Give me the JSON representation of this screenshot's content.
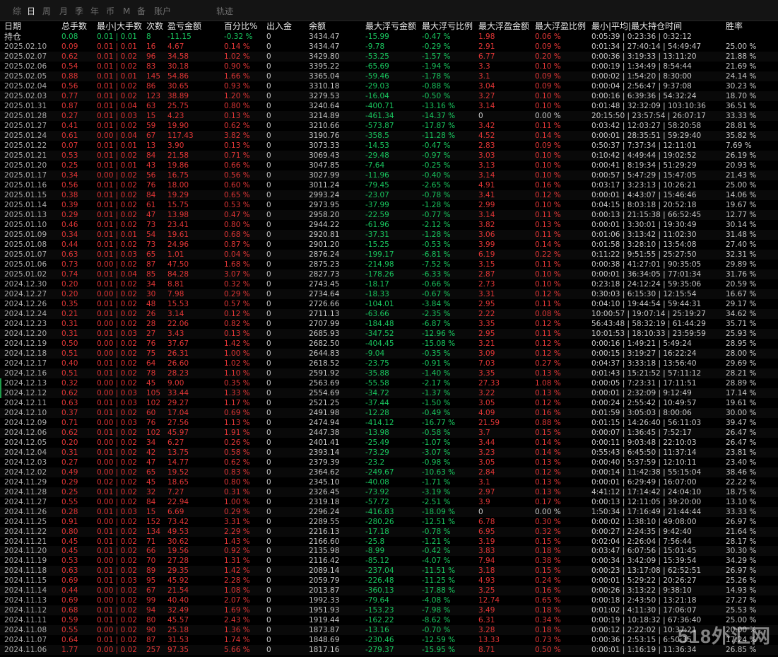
{
  "tabs": [
    {
      "label": "综",
      "active": false
    },
    {
      "label": "日",
      "active": true
    },
    {
      "label": "周",
      "active": false
    },
    {
      "label": "月",
      "active": false
    },
    {
      "label": "季",
      "active": false
    },
    {
      "label": "年",
      "active": false
    },
    {
      "label": "币",
      "active": false
    },
    {
      "label": "M",
      "active": false
    },
    {
      "label": "备",
      "active": false
    },
    {
      "label": "账户",
      "active": false
    },
    {
      "label": "轨迹",
      "active": false
    }
  ],
  "columns": [
    "日期",
    "总手数",
    "最小|大手数",
    "次数",
    "盈亏金额",
    "百分比%",
    "出入金",
    "余额",
    "最大浮亏金额",
    "最大浮亏比例",
    "最大浮盈金额",
    "最大浮盈比例",
    "最小|平均|最大持仓时间",
    "胜率"
  ],
  "holding": {
    "date": "持仓",
    "lots": "0.08",
    "minmax": "0.01 | 0.01",
    "count": "8",
    "pnl": "-11.15",
    "pct": "-0.32 %",
    "flow": "0",
    "balance": "3434.47",
    "maxloss": "-15.99",
    "maxloss_pct": "-0.47 %",
    "maxprofit": "1.98",
    "maxprofit_pct": "0.06 %",
    "time": "0:05:39 | 0:23:36 | 0:32:12",
    "winrate": ""
  },
  "rows": [
    [
      "2025.02.10",
      "0.09",
      "0.01 | 0.01",
      "16",
      "4.67",
      "0.14 %",
      "0",
      "3434.47",
      "-9.78",
      "-0.29 %",
      "2.91",
      "0.09 %",
      "0:01:34 | 27:40:14 | 54:49:47",
      "25.00 %"
    ],
    [
      "2025.02.07",
      "0.62",
      "0.01 | 0.02",
      "96",
      "34.58",
      "1.02 %",
      "0",
      "3429.80",
      "-53.25",
      "-1.57 %",
      "6.77",
      "0.20 %",
      "0:00:36 | 3:19:33 | 13:11:20",
      "21.88 %"
    ],
    [
      "2025.02.06",
      "0.54",
      "0.01 | 0.02",
      "83",
      "30.18",
      "0.90 %",
      "0",
      "3395.22",
      "-65.69",
      "-1.94 %",
      "3.3",
      "0.10 %",
      "0:00:19 | 1:34:49 | 8:54:44",
      "21.69 %"
    ],
    [
      "2025.02.05",
      "0.88",
      "0.01 | 0.01",
      "145",
      "54.86",
      "1.66 %",
      "0",
      "3365.04",
      "-59.46",
      "-1.78 %",
      "3.1",
      "0.09 %",
      "0:00:02 | 1:54:20 | 8:30:00",
      "24.14 %"
    ],
    [
      "2025.02.04",
      "0.56",
      "0.01 | 0.02",
      "86",
      "30.65",
      "0.93 %",
      "0",
      "3310.18",
      "-29.03",
      "-0.88 %",
      "3.04",
      "0.09 %",
      "0:00:04 | 2:56:47 | 9:37:08",
      "30.23 %"
    ],
    [
      "2025.02.03",
      "0.77",
      "0.01 | 0.02",
      "123",
      "38.89",
      "1.20 %",
      "0",
      "3279.53",
      "-16.04",
      "-0.50 %",
      "3.27",
      "0.10 %",
      "0:00:16 | 6:39:36 | 54:32:24",
      "18.70 %"
    ],
    [
      "2025.01.31",
      "0.87",
      "0.01 | 0.04",
      "63",
      "25.75",
      "0.80 %",
      "0",
      "3240.64",
      "-400.71",
      "-13.16 %",
      "3.14",
      "0.10 %",
      "0:01:48 | 32:32:09 | 103:10:36",
      "36.51 %"
    ],
    [
      "2025.01.28",
      "0.27",
      "0.01 | 0.03",
      "15",
      "4.23",
      "0.13 %",
      "0",
      "3214.89",
      "-461.34",
      "-14.37 %",
      "0",
      "0.00 %",
      "20:15:50 | 23:57:54 | 26:07:17",
      "33.33 %"
    ],
    [
      "2025.01.27",
      "0.41",
      "0.01 | 0.02",
      "59",
      "19.90",
      "0.62 %",
      "0",
      "3210.66",
      "-573.87",
      "-17.87 %",
      "3.42",
      "0.11 %",
      "0:03:42 | 12:03:27 | 58:20:58",
      "28.81 %"
    ],
    [
      "2025.01.24",
      "0.61",
      "0.00 | 0.04",
      "67",
      "117.43",
      "3.82 %",
      "0",
      "3190.76",
      "-358.5",
      "-11.28 %",
      "4.52",
      "0.14 %",
      "0:00:01 | 28:35:51 | 59:29:40",
      "35.82 %"
    ],
    [
      "2025.01.22",
      "0.07",
      "0.01 | 0.01",
      "13",
      "3.90",
      "0.13 %",
      "0",
      "3073.33",
      "-14.53",
      "-0.47 %",
      "2.83",
      "0.09 %",
      "0:50:37 | 7:37:34 | 12:11:01",
      "7.69 %"
    ],
    [
      "2025.01.21",
      "0.53",
      "0.01 | 0.02",
      "84",
      "21.58",
      "0.71 %",
      "0",
      "3069.43",
      "-29.48",
      "-0.97 %",
      "3.03",
      "0.10 %",
      "0:10:42 | 4:49:44 | 19:02:52",
      "26.19 %"
    ],
    [
      "2025.01.20",
      "0.25",
      "0.01 | 0.01",
      "43",
      "19.86",
      "0.66 %",
      "0",
      "3047.85",
      "-7.64",
      "-0.25 %",
      "3.13",
      "0.10 %",
      "0:00:41 | 8:19:34 | 51:29:29",
      "20.93 %"
    ],
    [
      "2025.01.17",
      "0.34",
      "0.00 | 0.02",
      "56",
      "16.75",
      "0.56 %",
      "0",
      "3027.99",
      "-11.96",
      "-0.40 %",
      "3.14",
      "0.10 %",
      "0:00:57 | 5:47:29 | 15:47:05",
      "21.43 %"
    ],
    [
      "2025.01.16",
      "0.56",
      "0.01 | 0.02",
      "76",
      "18.00",
      "0.60 %",
      "0",
      "3011.24",
      "-79.45",
      "-2.65 %",
      "4.91",
      "0.16 %",
      "0:03:17 | 3:23:13 | 10:26:21",
      "25.00 %"
    ],
    [
      "2025.01.15",
      "0.38",
      "0.01 | 0.02",
      "84",
      "19.29",
      "0.65 %",
      "0",
      "2993.24",
      "-23.07",
      "-0.78 %",
      "3.41",
      "0.12 %",
      "0:00:01 | 4:43:07 | 15:46:46",
      "14.06 %"
    ],
    [
      "2025.01.14",
      "0.39",
      "0.01 | 0.02",
      "61",
      "15.75",
      "0.53 %",
      "0",
      "2973.95",
      "-37.99",
      "-1.28 %",
      "2.99",
      "0.10 %",
      "0:04:15 | 8:03:18 | 20:52:18",
      "19.67 %"
    ],
    [
      "2025.01.13",
      "0.29",
      "0.01 | 0.02",
      "47",
      "13.98",
      "0.47 %",
      "0",
      "2958.20",
      "-22.59",
      "-0.77 %",
      "3.14",
      "0.11 %",
      "0:00:13 | 21:15:38 | 66:52:45",
      "12.77 %"
    ],
    [
      "2025.01.10",
      "0.46",
      "0.01 | 0.02",
      "73",
      "23.41",
      "0.80 %",
      "0",
      "2944.22",
      "-61.96",
      "-2.12 %",
      "3.82",
      "0.13 %",
      "0:00:01 | 3:30:01 | 19:30:49",
      "30.14 %"
    ],
    [
      "2025.01.09",
      "0.34",
      "0.01 | 0.01",
      "54",
      "19.61",
      "0.68 %",
      "0",
      "2920.81",
      "-37.31",
      "-1.28 %",
      "3.06",
      "0.11 %",
      "0:01:06 | 3:13:42 | 11:02:30",
      "31.48 %"
    ],
    [
      "2025.01.08",
      "0.44",
      "0.01 | 0.02",
      "73",
      "24.96",
      "0.87 %",
      "0",
      "2901.20",
      "-15.25",
      "-0.53 %",
      "3.99",
      "0.14 %",
      "0:01:58 | 3:28:10 | 13:54:08",
      "27.40 %"
    ],
    [
      "2025.01.07",
      "0.63",
      "0.01 | 0.03",
      "65",
      "1.01",
      "0.04 %",
      "0",
      "2876.24",
      "-199.17",
      "-6.81 %",
      "6.19",
      "0.22 %",
      "0:11:22 | 9:51:55 | 25:27:50",
      "32.31 %"
    ],
    [
      "2025.01.06",
      "0.73",
      "0.00 | 0.02",
      "87",
      "47.50",
      "1.68 %",
      "0",
      "2875.23",
      "-214.98",
      "-7.52 %",
      "3.15",
      "0.11 %",
      "0:00:38 | 41:27:01 | 90:35:05",
      "29.89 %"
    ],
    [
      "2025.01.02",
      "0.74",
      "0.01 | 0.04",
      "85",
      "84.28",
      "3.07 %",
      "0",
      "2827.73",
      "-178.26",
      "-6.33 %",
      "2.87",
      "0.10 %",
      "0:00:01 | 36:34:05 | 77:01:34",
      "31.76 %"
    ],
    [
      "2024.12.30",
      "0.20",
      "0.01 | 0.02",
      "34",
      "8.81",
      "0.32 %",
      "0",
      "2743.45",
      "-18.17",
      "-0.66 %",
      "2.73",
      "0.10 %",
      "0:23:18 | 24:12:24 | 59:35:06",
      "20.59 %"
    ],
    [
      "2024.12.27",
      "0.20",
      "0.00 | 0.02",
      "30",
      "7.98",
      "0.29 %",
      "0",
      "2734.64",
      "-18.33",
      "-0.67 %",
      "3.31",
      "0.12 %",
      "0:30:03 | 6:15:30 | 12:15:54",
      "16.67 %"
    ],
    [
      "2024.12.26",
      "0.35",
      "0.01 | 0.02",
      "48",
      "15.53",
      "0.57 %",
      "0",
      "2726.66",
      "-104.01",
      "-3.84 %",
      "2.95",
      "0.11 %",
      "0:04:10 | 19:44:54 | 59:44:31",
      "29.17 %"
    ],
    [
      "2024.12.24",
      "0.21",
      "0.01 | 0.02",
      "26",
      "3.14",
      "0.12 %",
      "0",
      "2711.13",
      "-63.66",
      "-2.35 %",
      "2.22",
      "0.08 %",
      "10:00:57 | 19:07:14 | 25:19:27",
      "34.62 %"
    ],
    [
      "2024.12.23",
      "0.31",
      "0.00 | 0.02",
      "28",
      "22.06",
      "0.82 %",
      "0",
      "2707.99",
      "-184.48",
      "-6.87 %",
      "3.35",
      "0.12 %",
      "56:43:48 | 58:32:19 | 61:44:29",
      "35.71 %"
    ],
    [
      "2024.12.20",
      "0.31",
      "0.01 | 0.03",
      "27",
      "3.43",
      "0.13 %",
      "0",
      "2685.93",
      "-347.52",
      "-12.96 %",
      "2.95",
      "0.11 %",
      "10:01:53 | 18:10:33 | 23:59:59",
      "25.93 %"
    ],
    [
      "2024.12.19",
      "0.50",
      "0.00 | 0.02",
      "76",
      "37.67",
      "1.42 %",
      "0",
      "2682.50",
      "-404.45",
      "-15.08 %",
      "3.21",
      "0.12 %",
      "0:00:16 | 1:49:21 | 5:49:24",
      "28.95 %"
    ],
    [
      "2024.12.18",
      "0.51",
      "0.00 | 0.02",
      "75",
      "26.31",
      "1.00 %",
      "0",
      "2644.83",
      "-9.04",
      "-0.35 %",
      "3.09",
      "0.12 %",
      "0:00:15 | 3:19:27 | 16:22:24",
      "28.00 %"
    ],
    [
      "2024.12.17",
      "0.40",
      "0.01 | 0.02",
      "64",
      "26.60",
      "1.02 %",
      "0",
      "2618.52",
      "-23.75",
      "-0.91 %",
      "7.03",
      "0.27 %",
      "0:04:37 | 3:33:18 | 13:56:40",
      "29.69 %"
    ],
    [
      "2024.12.16",
      "0.51",
      "0.01 | 0.02",
      "78",
      "28.23",
      "1.10 %",
      "0",
      "2591.92",
      "-35.88",
      "-1.40 %",
      "3.35",
      "0.13 %",
      "0:01:43 | 15:21:52 | 57:11:12",
      "28.21 %"
    ],
    [
      "2024.12.13",
      "0.32",
      "0.00 | 0.02",
      "45",
      "9.00",
      "0.35 %",
      "0",
      "2563.69",
      "-55.58",
      "-2.17 %",
      "27.33",
      "1.08 %",
      "0:00:05 | 7:23:31 | 17:11:51",
      "28.89 %"
    ],
    [
      "2024.12.12",
      "0.62",
      "0.00 | 0.03",
      "105",
      "33.44",
      "1.33 %",
      "0",
      "2554.69",
      "-34.72",
      "-1.37 %",
      "3.22",
      "0.13 %",
      "0:00:01 | 2:32:09 | 9:12:49",
      "17.14 %"
    ],
    [
      "2024.12.11",
      "0.63",
      "0.01 | 0.03",
      "102",
      "29.27",
      "1.17 %",
      "0",
      "2521.25",
      "-37.44",
      "-1.50 %",
      "3.05",
      "0.12 %",
      "0:00:24 | 2:55:42 | 10:49:57",
      "19.61 %"
    ],
    [
      "2024.12.10",
      "0.37",
      "0.01 | 0.02",
      "60",
      "17.04",
      "0.69 %",
      "0",
      "2491.98",
      "-12.28",
      "-0.49 %",
      "4.09",
      "0.16 %",
      "0:01:59 | 3:05:03 | 8:00:06",
      "30.00 %"
    ],
    [
      "2024.12.09",
      "0.71",
      "0.00 | 0.03",
      "76",
      "27.56",
      "1.13 %",
      "0",
      "2474.94",
      "-414.12",
      "-16.77 %",
      "21.59",
      "0.88 %",
      "0:01:15 | 14:26:40 | 56:11:03",
      "39.47 %"
    ],
    [
      "2024.12.06",
      "0.62",
      "0.01 | 0.02",
      "102",
      "45.97",
      "1.91 %",
      "0",
      "2447.38",
      "-13.98",
      "-0.58 %",
      "3.7",
      "0.15 %",
      "0:00:07 | 1:36:45 | 7:52:17",
      "26.47 %"
    ],
    [
      "2024.12.05",
      "0.20",
      "0.00 | 0.02",
      "34",
      "6.27",
      "0.26 %",
      "0",
      "2401.41",
      "-25.49",
      "-1.07 %",
      "3.44",
      "0.14 %",
      "0:00:11 | 9:03:48 | 22:10:03",
      "26.47 %"
    ],
    [
      "2024.12.04",
      "0.31",
      "0.01 | 0.02",
      "42",
      "13.75",
      "0.58 %",
      "0",
      "2393.14",
      "-73.29",
      "-3.07 %",
      "3.23",
      "0.14 %",
      "0:55:43 | 6:45:50 | 11:37:14",
      "23.81 %"
    ],
    [
      "2024.12.03",
      "0.27",
      "0.00 | 0.02",
      "47",
      "14.77",
      "0.62 %",
      "0",
      "2379.39",
      "-23.2",
      "-0.98 %",
      "3.05",
      "0.13 %",
      "0:00:40 | 5:37:59 | 12:10:11",
      "23.40 %"
    ],
    [
      "2024.12.02",
      "0.49",
      "0.00 | 0.02",
      "65",
      "19.52",
      "0.83 %",
      "0",
      "2364.62",
      "-249.67",
      "-10.63 %",
      "2.84",
      "0.12 %",
      "0:00:14 | 11:42:38 | 55:15:04",
      "38.46 %"
    ],
    [
      "2024.11.29",
      "0.29",
      "0.02 | 0.02",
      "45",
      "18.65",
      "0.80 %",
      "0",
      "2345.10",
      "-40.08",
      "-1.71 %",
      "3.1",
      "0.13 %",
      "0:00:01 | 6:29:49 | 16:07:00",
      "22.22 %"
    ],
    [
      "2024.11.28",
      "0.25",
      "0.01 | 0.02",
      "32",
      "7.27",
      "0.31 %",
      "0",
      "2326.45",
      "-73.92",
      "-3.19 %",
      "2.97",
      "0.13 %",
      "4:41:12 | 17:14:42 | 24:04:10",
      "18.75 %"
    ],
    [
      "2024.11.27",
      "0.55",
      "0.00 | 0.02",
      "84",
      "22.94",
      "1.00 %",
      "0",
      "2319.18",
      "-57.72",
      "-2.51 %",
      "3.9",
      "0.17 %",
      "0:00:13 | 12:11:05 | 39:20:00",
      "13.10 %"
    ],
    [
      "2024.11.26",
      "0.28",
      "0.01 | 0.03",
      "15",
      "6.69",
      "0.29 %",
      "0",
      "2296.24",
      "-416.83",
      "-18.09 %",
      "0",
      "0.00 %",
      "1:50:34 | 17:16:49 | 21:44:44",
      "33.33 %"
    ],
    [
      "2024.11.25",
      "0.91",
      "0.00 | 0.02",
      "152",
      "73.42",
      "3.31 %",
      "0",
      "2289.55",
      "-280.26",
      "-12.51 %",
      "6.78",
      "0.30 %",
      "0:00:02 | 1:38:10 | 49:08:00",
      "26.97 %"
    ],
    [
      "2024.11.22",
      "0.80",
      "0.01 | 0.02",
      "134",
      "49.53",
      "2.29 %",
      "0",
      "2216.13",
      "-17.18",
      "-0.78 %",
      "6.95",
      "0.32 %",
      "0:00:27 | 2:24:35 | 9:42:40",
      "21.64 %"
    ],
    [
      "2024.11.21",
      "0.45",
      "0.01 | 0.02",
      "71",
      "30.62",
      "1.43 %",
      "0",
      "2166.60",
      "-25.8",
      "-1.21 %",
      "3.19",
      "0.15 %",
      "0:02:04 | 2:26:04 | 7:56:44",
      "28.17 %"
    ],
    [
      "2024.11.20",
      "0.45",
      "0.01 | 0.02",
      "66",
      "19.56",
      "0.92 %",
      "0",
      "2135.98",
      "-8.99",
      "-0.42 %",
      "3.83",
      "0.18 %",
      "0:03:47 | 6:07:56 | 15:01:45",
      "30.30 %"
    ],
    [
      "2024.11.19",
      "0.53",
      "0.00 | 0.02",
      "70",
      "27.28",
      "1.31 %",
      "0",
      "2116.42",
      "-85.12",
      "-4.07 %",
      "7.94",
      "0.38 %",
      "0:00:34 | 3:42:09 | 15:39:54",
      "34.29 %"
    ],
    [
      "2024.11.18",
      "0.63",
      "0.01 | 0.02",
      "89",
      "29.35",
      "1.42 %",
      "0",
      "2089.14",
      "-237.04",
      "-11.51 %",
      "3.18",
      "0.15 %",
      "0:00:23 | 13:17:08 | 62:52:51",
      "26.97 %"
    ],
    [
      "2024.11.15",
      "0.69",
      "0.01 | 0.03",
      "95",
      "45.92",
      "2.28 %",
      "0",
      "2059.79",
      "-226.48",
      "-11.25 %",
      "4.93",
      "0.24 %",
      "0:00:01 | 5:29:22 | 20:26:27",
      "25.26 %"
    ],
    [
      "2024.11.14",
      "0.44",
      "0.00 | 0.02",
      "67",
      "21.54",
      "1.08 %",
      "0",
      "2013.87",
      "-360.13",
      "-17.88 %",
      "3.25",
      "0.16 %",
      "0:00:26 | 3:13:22 | 9:38:10",
      "14.93 %"
    ],
    [
      "2024.11.13",
      "0.69",
      "0.00 | 0.02",
      "99",
      "40.40",
      "2.07 %",
      "0",
      "1992.33",
      "-79.64",
      "-4.08 %",
      "12.74",
      "0.65 %",
      "0:00:18 | 2:43:50 | 13:21:18",
      "27.27 %"
    ],
    [
      "2024.11.12",
      "0.68",
      "0.01 | 0.02",
      "94",
      "32.49",
      "1.69 %",
      "0",
      "1951.93",
      "-153.23",
      "-7.98 %",
      "3.49",
      "0.18 %",
      "0:01:02 | 4:11:30 | 17:06:07",
      "25.53 %"
    ],
    [
      "2024.11.11",
      "0.59",
      "0.01 | 0.02",
      "80",
      "45.57",
      "2.43 %",
      "0",
      "1919.44",
      "-162.22",
      "-8.62 %",
      "6.31",
      "0.34 %",
      "0:00:19 | 10:18:32 | 67:36:40",
      "25.00 %"
    ],
    [
      "2024.11.08",
      "0.55",
      "0.00 | 0.02",
      "90",
      "25.18",
      "1.36 %",
      "0",
      "1873.87",
      "-13.16",
      "-0.70 %",
      "3.28",
      "0.18 %",
      "0:00:12 | 2:22:02 | 10:37:21",
      "20.00 %"
    ],
    [
      "2024.11.07",
      "0.64",
      "0.01 | 0.02",
      "87",
      "31.53",
      "1.74 %",
      "0",
      "1848.69",
      "-230.46",
      "-12.59 %",
      "13.33",
      "0.73 %",
      "0:00:36 | 2:53:15 | 6:50:35",
      "17.24 %"
    ],
    [
      "2024.11.06",
      "1.77",
      "0.00 | 0.02",
      "257",
      "97.35",
      "5.66 %",
      "0",
      "1817.16",
      "-279.37",
      "-15.95 %",
      "8.71",
      "0.50 %",
      "0:00:01 | 1:16:19 | 11:36:34",
      "26.85 %"
    ]
  ],
  "colors": {
    "red": "#e13636",
    "green": "#19c75f",
    "text": "#c8c8c8",
    "bg": "#000000"
  },
  "watermark": "518外汇网"
}
